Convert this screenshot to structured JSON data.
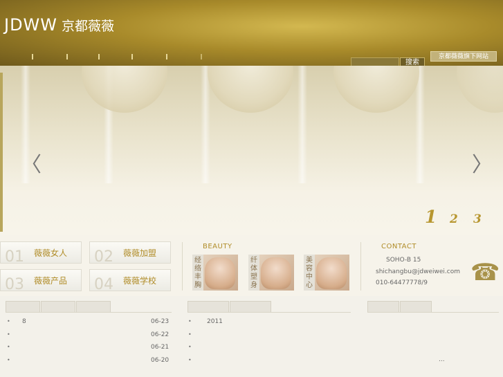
{
  "header": {
    "logo_latin": "JDWW",
    "logo_cn": "京都薇薇",
    "search_button": "搜索",
    "search_placeholder": "",
    "sub_link": "京都薇薇旗下网站"
  },
  "banner": {
    "prev_arrow": "〈",
    "next_arrow": "〉",
    "pages": [
      "1",
      "2",
      "3"
    ],
    "active_page": "1"
  },
  "tiles": [
    {
      "num": "01",
      "label": "薇薇女人"
    },
    {
      "num": "02",
      "label": "薇薇加盟"
    },
    {
      "num": "03",
      "label": "薇薇产品"
    },
    {
      "num": "04",
      "label": "薇薇学校"
    }
  ],
  "beauty": {
    "title": "BEAUTY",
    "items": [
      {
        "tag": "经络丰胸"
      },
      {
        "tag": "纤体塑身"
      },
      {
        "tag": "美容中心"
      }
    ]
  },
  "contact": {
    "title": "CONTACT",
    "address": "SOHO-B 15",
    "email": "shichangbu@jdweiwei.com",
    "phone": "010-64477778/9",
    "icon": "phone-icon"
  },
  "lists": {
    "left": [
      {
        "text": "8",
        "date": "06-23"
      },
      {
        "text": "",
        "date": "06-22"
      },
      {
        "text": "",
        "date": "06-21"
      },
      {
        "text": "",
        "date": "06-20"
      }
    ],
    "middle": [
      {
        "text": "2011"
      },
      {
        "text": ""
      },
      {
        "text": ""
      },
      {
        "text": ""
      }
    ],
    "right_more": "..."
  },
  "colors": {
    "header_gold": "#a88a2a",
    "accent": "#b08c28"
  }
}
